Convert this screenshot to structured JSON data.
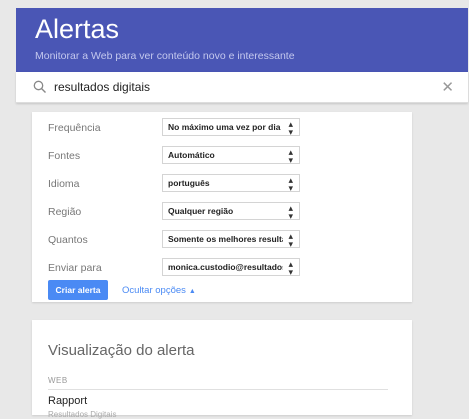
{
  "header": {
    "title": "Alertas",
    "subtitle": "Monitorar a Web para ver conteúdo novo e interessante"
  },
  "search": {
    "value": "resultados digitais",
    "icon": "search-icon",
    "clear_icon": "close-icon"
  },
  "options": [
    {
      "label": "Frequência",
      "value": "No máximo uma vez por dia"
    },
    {
      "label": "Fontes",
      "value": "Automático"
    },
    {
      "label": "Idioma",
      "value": "português"
    },
    {
      "label": "Região",
      "value": "Qualquer região"
    },
    {
      "label": "Quantos",
      "value": "Somente os melhores resultados"
    },
    {
      "label": "Enviar para",
      "value": "monica.custodio@resultadosdigitais"
    }
  ],
  "actions": {
    "create_label": "Criar alerta",
    "hide_options_label": "Ocultar opções",
    "hide_options_arrow": "▲"
  },
  "preview": {
    "title": "Visualização do alerta",
    "section": "WEB",
    "item_title": "Rapport",
    "item_source": "Resultados Digitais"
  },
  "colors": {
    "header_bg": "#4a56b5",
    "button_bg": "#4a8af4",
    "link": "#4a8af4"
  }
}
